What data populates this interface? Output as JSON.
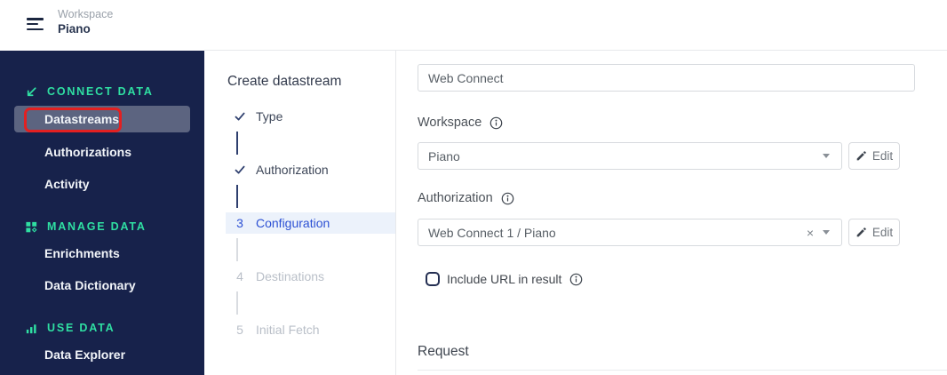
{
  "topbar": {
    "workspace_label": "Workspace",
    "workspace_name": "Piano"
  },
  "sidebar": {
    "sections": [
      {
        "label": "CONNECT DATA",
        "icon": "arrow-down-left-icon",
        "items": [
          {
            "label": "Datastreams",
            "selected": true,
            "annotated": true
          },
          {
            "label": "Authorizations",
            "selected": false
          },
          {
            "label": "Activity",
            "selected": false
          }
        ]
      },
      {
        "label": "MANAGE DATA",
        "icon": "grid-icon",
        "items": [
          {
            "label": "Enrichments",
            "selected": false
          },
          {
            "label": "Data Dictionary",
            "selected": false
          }
        ]
      },
      {
        "label": "USE DATA",
        "icon": "bar-chart-icon",
        "items": [
          {
            "label": "Data Explorer",
            "selected": false
          }
        ]
      }
    ]
  },
  "stepper": {
    "title": "Create datastream",
    "steps": [
      {
        "label": "Type",
        "status": "done"
      },
      {
        "label": "Authorization",
        "status": "done"
      },
      {
        "number": "3",
        "label": "Configuration",
        "status": "active"
      },
      {
        "number": "4",
        "label": "Destinations",
        "status": "pending"
      },
      {
        "number": "5",
        "label": "Initial Fetch",
        "status": "pending"
      }
    ]
  },
  "form": {
    "name_input": {
      "value": "Web Connect"
    },
    "workspace": {
      "label": "Workspace",
      "value": "Piano",
      "edit_label": "Edit"
    },
    "authorization": {
      "label": "Authorization",
      "value": "Web Connect 1 / Piano",
      "edit_label": "Edit"
    },
    "include_url": {
      "label": "Include URL in result",
      "checked": false
    },
    "request_heading": "Request"
  },
  "colors": {
    "sidebar_bg": "#17224b",
    "accent_teal": "#2fdfa2",
    "selected_item_bg": "#5c6480",
    "annotation_red": "#e32021",
    "active_step_blue": "#2d51d4",
    "active_step_bg": "#ecf2fb"
  }
}
